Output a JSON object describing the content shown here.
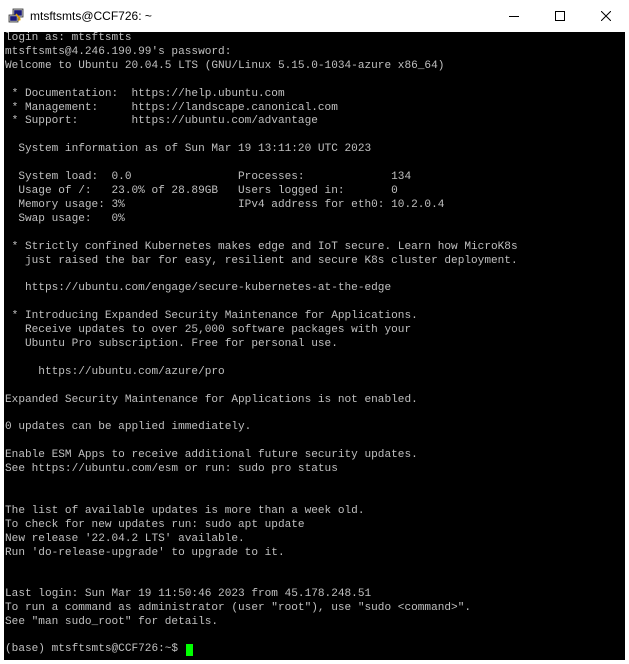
{
  "window": {
    "title": "mtsftsmts@CCF726: ~",
    "icon": "putty-icon",
    "controls": {
      "minimize": "minimize-icon",
      "maximize": "maximize-icon",
      "close": "close-icon"
    }
  },
  "terminal": {
    "background": "#000000",
    "foreground": "#c0c0c0",
    "cursor_color": "#00ff00",
    "lines": [
      "login as: mtsftsmts",
      "mtsftsmts@4.246.190.99's password:",
      "Welcome to Ubuntu 20.04.5 LTS (GNU/Linux 5.15.0-1034-azure x86_64)",
      "",
      " * Documentation:  https://help.ubuntu.com",
      " * Management:     https://landscape.canonical.com",
      " * Support:        https://ubuntu.com/advantage",
      "",
      "  System information as of Sun Mar 19 13:11:20 UTC 2023",
      "",
      "  System load:  0.0                Processes:             134",
      "  Usage of /:   23.0% of 28.89GB   Users logged in:       0",
      "  Memory usage: 3%                 IPv4 address for eth0: 10.2.0.4",
      "  Swap usage:   0%",
      "",
      " * Strictly confined Kubernetes makes edge and IoT secure. Learn how MicroK8s",
      "   just raised the bar for easy, resilient and secure K8s cluster deployment.",
      "",
      "   https://ubuntu.com/engage/secure-kubernetes-at-the-edge",
      "",
      " * Introducing Expanded Security Maintenance for Applications.",
      "   Receive updates to over 25,000 software packages with your",
      "   Ubuntu Pro subscription. Free for personal use.",
      "",
      "     https://ubuntu.com/azure/pro",
      "",
      "Expanded Security Maintenance for Applications is not enabled.",
      "",
      "0 updates can be applied immediately.",
      "",
      "Enable ESM Apps to receive additional future security updates.",
      "See https://ubuntu.com/esm or run: sudo pro status",
      "",
      "",
      "The list of available updates is more than a week old.",
      "To check for new updates run: sudo apt update",
      "New release '22.04.2 LTS' available.",
      "Run 'do-release-upgrade' to upgrade to it.",
      "",
      "",
      "Last login: Sun Mar 19 11:50:46 2023 from 45.178.248.51",
      "To run a command as administrator (user \"root\"), use \"sudo <command>\".",
      "See \"man sudo_root\" for details.",
      ""
    ],
    "prompt": "(base) mtsftsmts@CCF726:~$ "
  }
}
